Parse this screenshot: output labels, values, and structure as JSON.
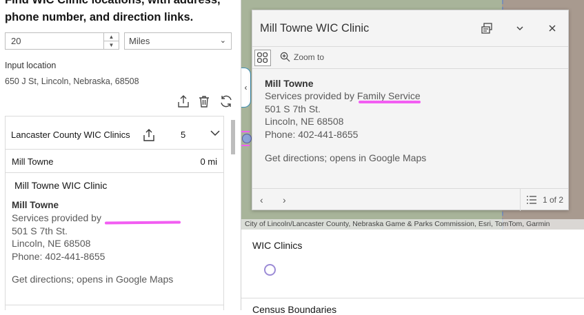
{
  "panel": {
    "intro": "Find WIC Clinic locations, with address, phone number, and direction links.",
    "distance_value": "20",
    "distance_unit": "Miles",
    "input_location_label": "Input location",
    "input_location_value": "650 J St, Lincoln, Nebraska, 68508"
  },
  "results": {
    "layer_title": "Lancaster County WIC Clinics",
    "count": "5",
    "row": {
      "name": "Mill Towne",
      "distance": "0 mi"
    },
    "detail": {
      "title": "Mill Towne WIC Clinic",
      "name": "Mill Towne",
      "services": "Services provided by",
      "address1": "501 S 7th St.",
      "address2": "Lincoln, NE 68508",
      "phone": "Phone: 402-441-8655",
      "directions": "Get directions; opens in Google Maps"
    }
  },
  "popup": {
    "title": "Mill Towne WIC Clinic",
    "zoom_label": "Zoom to",
    "name": "Mill Towne",
    "services_prefix": "Services provided by ",
    "services_org": "Family Service",
    "address1": "501 S 7th St.",
    "address2": "Lincoln, NE 68508",
    "phone": "Phone: 402-441-8655",
    "directions": "Get directions; opens in Google Maps",
    "page": "1 of 2"
  },
  "map": {
    "attribution": "City of Lincoln/Lancaster County, Nebraska Game & Parks Commission, Esri, TomTom, Garmin"
  },
  "legend": {
    "title": "WIC Clinics",
    "next_title": "Census Boundaries"
  },
  "colors": {
    "highlight": "#f25df2",
    "accent": "#3c8fb5"
  }
}
